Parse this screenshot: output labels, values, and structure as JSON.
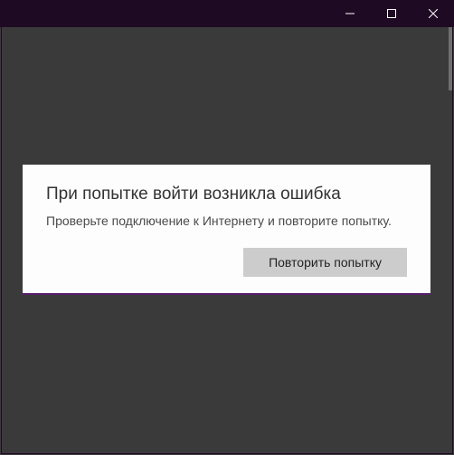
{
  "titlebar": {
    "minimize_icon": "minimize",
    "maximize_icon": "maximize",
    "close_icon": "close"
  },
  "dialog": {
    "title": "При попытке войти возникла ошибка",
    "message": "Проверьте подключение к Интернету и повторите попытку.",
    "retry_label": "Повторить попытку"
  }
}
